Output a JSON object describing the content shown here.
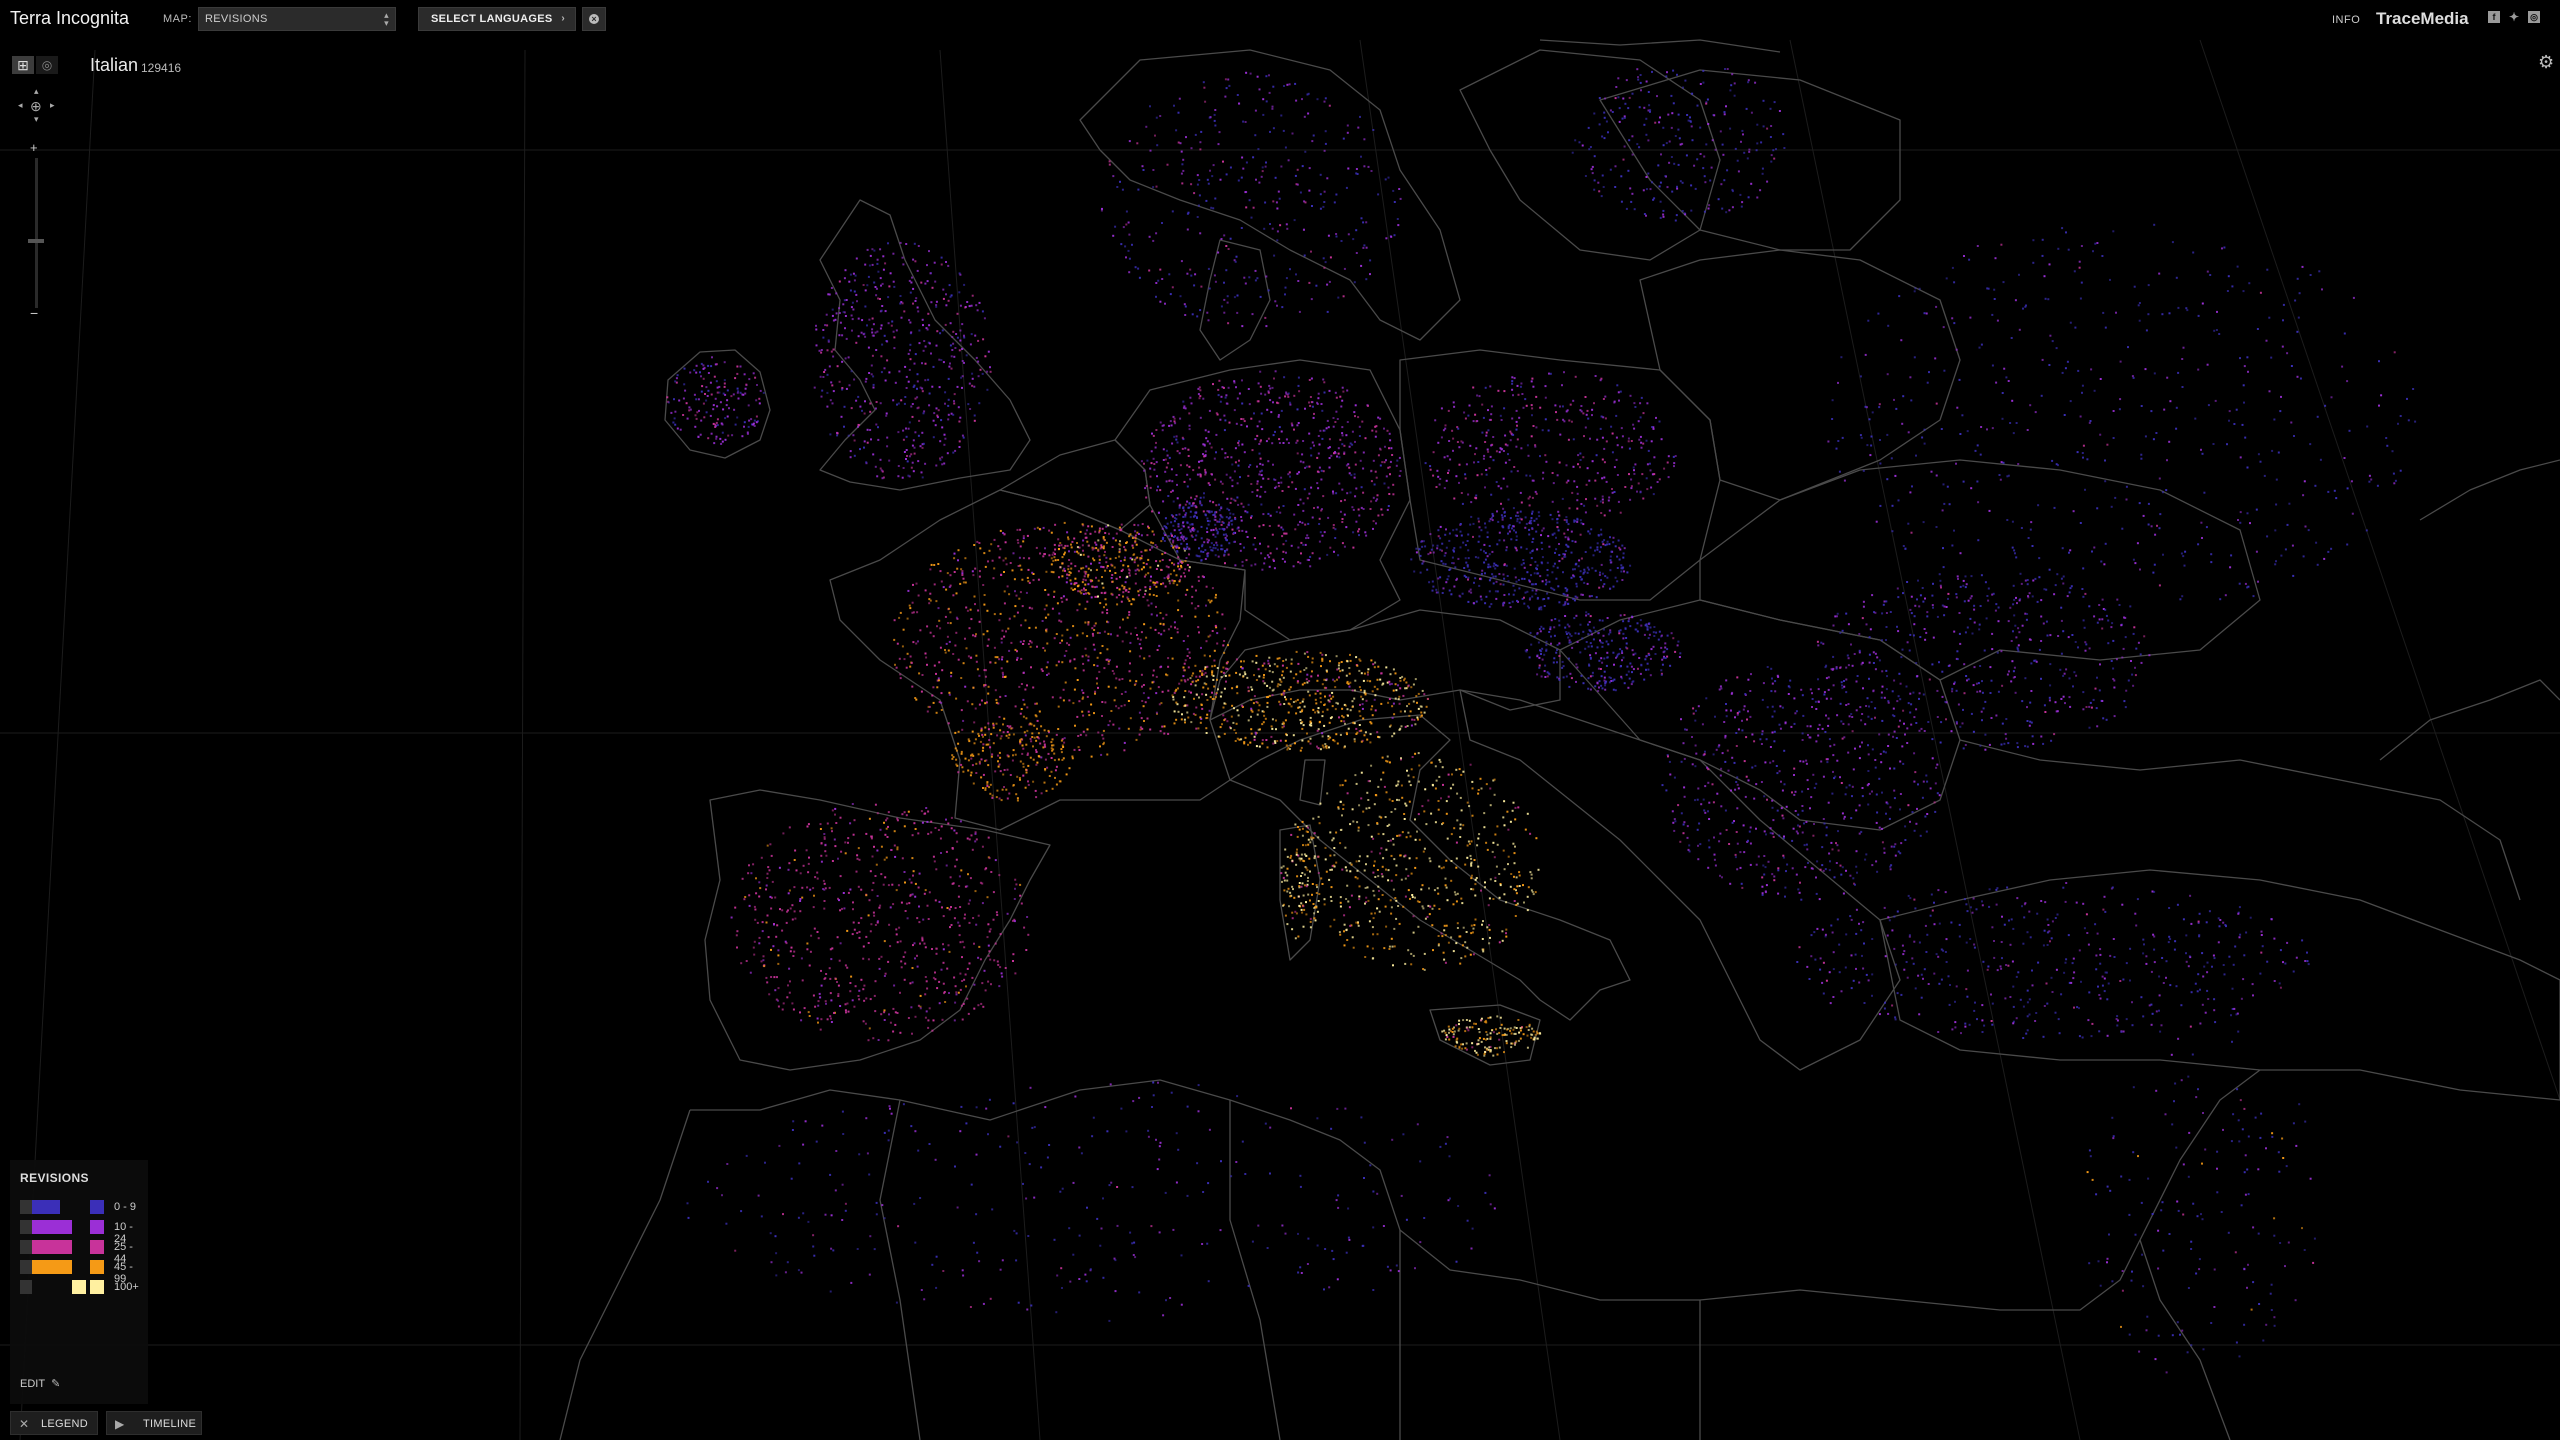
{
  "header": {
    "app_title": "Terra Incognita",
    "map_label": "MAP:",
    "map_select_value": "REVISIONS",
    "select_languages_label": "SELECT LANGUAGES",
    "info_label": "INFO",
    "brand": "TraceMedia"
  },
  "selection": {
    "language": "Italian",
    "count": "129416"
  },
  "legend": {
    "title": "REVISIONS",
    "items": [
      {
        "label": "0 - 9",
        "color": "#3b2fb8"
      },
      {
        "label": "10 - 24",
        "color": "#9b2fd6"
      },
      {
        "label": "25 - 44",
        "color": "#c8339a"
      },
      {
        "label": "45 - 99",
        "color": "#f59a16"
      },
      {
        "label": "100+",
        "color": "#fff0a0"
      }
    ],
    "edit_label": "EDIT"
  },
  "footer": {
    "legend_button": "LEGEND",
    "timeline_button": "TIMELINE"
  },
  "icons": {
    "social": [
      "facebook-icon",
      "twitter-icon",
      "rss-icon"
    ],
    "controls": [
      "pan-icon",
      "zoom-in-icon",
      "zoom-out-icon",
      "settings-gear-icon",
      "pencil-icon",
      "play-icon",
      "close-icon"
    ]
  },
  "colors": {
    "background": "#000000",
    "borders": "#4a4a4a"
  }
}
